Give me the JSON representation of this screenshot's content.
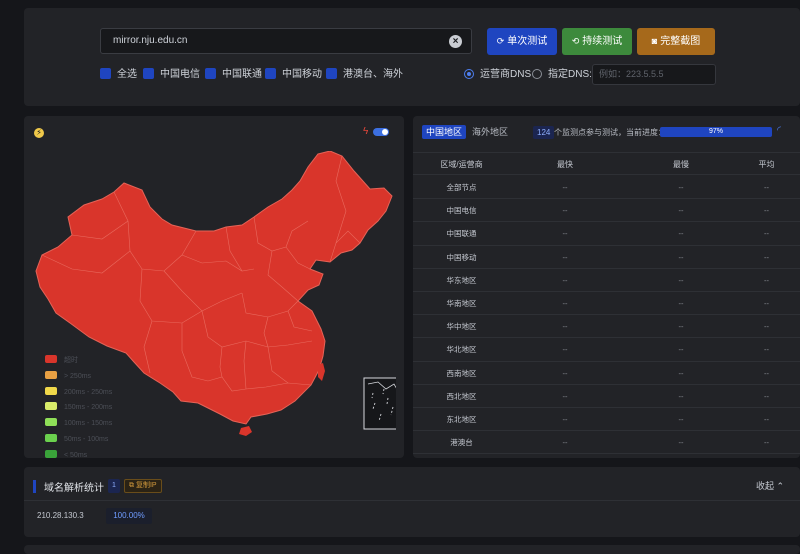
{
  "search": {
    "value": "mirror.nju.edu.cn",
    "clear_icon": "close-circle-icon"
  },
  "actions": {
    "single_test": "单次测试",
    "continuous_test": "持续测试",
    "full_screenshot": "完整截图",
    "colors": {
      "single": "#1f45c0",
      "continuous": "#3d8a3c",
      "screenshot": "#a6691b"
    }
  },
  "carriers": [
    {
      "label": "全选",
      "checked": true
    },
    {
      "label": "中国电信",
      "checked": true
    },
    {
      "label": "中国联通",
      "checked": true
    },
    {
      "label": "中国移动",
      "checked": true
    },
    {
      "label": "港澳台、海外",
      "checked": true
    }
  ],
  "dns": {
    "option_carrier": "运营商DNS",
    "option_custom": "指定DNS:",
    "selected": "option_carrier",
    "placeholder": "例如：223.5.5.5"
  },
  "map": {
    "fill_color": "#d9352b",
    "legend": [
      {
        "label": "超时",
        "color": "#d9352b"
      },
      {
        "label": "> 250ms",
        "color": "#e8a043"
      },
      {
        "label": "200ms - 250ms",
        "color": "#f0d84a"
      },
      {
        "label": "150ms - 200ms",
        "color": "#d9ec6a"
      },
      {
        "label": "100ms - 150ms",
        "color": "#8fdf58"
      },
      {
        "label": "50ms - 100ms",
        "color": "#6bd14e"
      },
      {
        "label": "< 50ms",
        "color": "#3aa33a"
      }
    ]
  },
  "results": {
    "tabs": [
      "中国地区",
      "海外地区"
    ],
    "active_tab": 0,
    "node_count": "124",
    "progress_text": "个监测点参与测试，当前进度：",
    "progress_label": "97%",
    "progress": 0.97,
    "columns": [
      "区域/运营商",
      "最快",
      "最慢",
      "平均"
    ],
    "rows": [
      [
        "全部节点",
        "--",
        "--",
        "--"
      ],
      [
        "中国电信",
        "--",
        "--",
        "--"
      ],
      [
        "中国联通",
        "--",
        "--",
        "--"
      ],
      [
        "中国移动",
        "--",
        "--",
        "--"
      ],
      [
        "华东地区",
        "--",
        "--",
        "--"
      ],
      [
        "华南地区",
        "--",
        "--",
        "--"
      ],
      [
        "华中地区",
        "--",
        "--",
        "--"
      ],
      [
        "华北地区",
        "--",
        "--",
        "--"
      ],
      [
        "西南地区",
        "--",
        "--",
        "--"
      ],
      [
        "西北地区",
        "--",
        "--",
        "--"
      ],
      [
        "东北地区",
        "--",
        "--",
        "--"
      ],
      [
        "港澳台",
        "--",
        "--",
        "--"
      ]
    ]
  },
  "dns_stats": {
    "title": "域名解析统计",
    "count": "1",
    "copy_label": "复制IP",
    "collapse_label": "收起",
    "entries": [
      {
        "ip": "210.28.130.3",
        "percent": "100.00%"
      }
    ]
  }
}
